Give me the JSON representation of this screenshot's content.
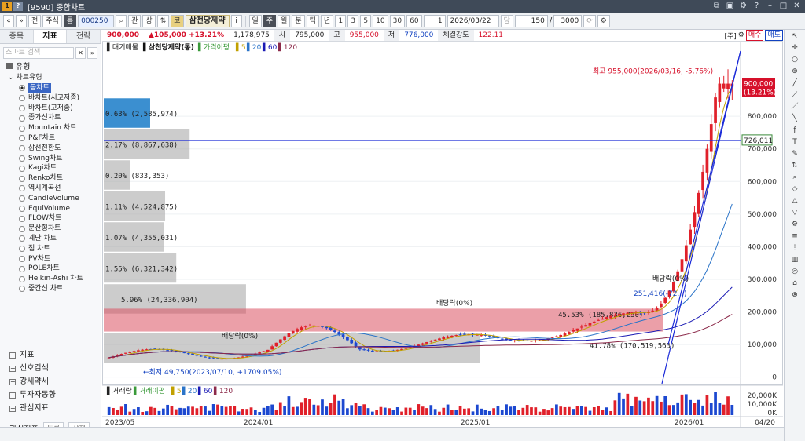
{
  "window": {
    "title": "[9590] 종합차트",
    "badge1": "1",
    "badge2": "?"
  },
  "toolbar": {
    "nav_prev": "«",
    "nav_next": "»",
    "btn_all": "전",
    "btn_stock": "주식",
    "btn_type": "통",
    "code": "000250",
    "btn_gwan": "관",
    "btn_sang": "상",
    "stock_name": "삼천당제약",
    "stock_badge": "코",
    "btn_info": "i",
    "periods": [
      "일",
      "주",
      "월",
      "분",
      "틱",
      "년",
      "1",
      "3",
      "5",
      "10",
      "30",
      "60"
    ],
    "period_selected": "주",
    "step": "1",
    "date": "2026/03/22",
    "btn_date": "당",
    "count": "150",
    "slash": "/",
    "total": "3000",
    "icons": [
      "search-icon",
      "sort-icon",
      "gear-icon"
    ]
  },
  "left_panel": {
    "tabs": [
      "종목",
      "지표",
      "전략"
    ],
    "active_tab": "지표",
    "search_placeholder": "스마트 검색",
    "section": "유형",
    "subsection": "차트유형",
    "chart_types": [
      "봉차트",
      "바차트(시고저종)",
      "바차트(고저종)",
      "종가선차트",
      "Mountain 차트",
      "P&F차트",
      "삼선전환도",
      "Swing차트",
      "Kagi차트",
      "Renko차트",
      "역시계곡선",
      "CandleVolume",
      "EquiVolume",
      "FLOW차트",
      "분산형차트",
      "계단 차트",
      "점 차트",
      "PV차트",
      "POLE차트",
      "Heikin-Ashi 차트",
      "중간선 차트"
    ],
    "selected_chart_type": "봉차트",
    "folders": [
      "지표",
      "신호검색",
      "강세약세",
      "투자자동향",
      "관심지표"
    ],
    "bottom_title": "관심지표",
    "bottom_btn1": "등록",
    "bottom_btn2": "삭제"
  },
  "quote": {
    "price": "900,000",
    "change": "▲105,000",
    "change_rate": "+13.21%",
    "volume": "1,178,975",
    "open_label": "시",
    "open": "795,000",
    "high_label": "고",
    "high": "955,000",
    "low_label": "저",
    "low": "776,000",
    "strength_label": "체결강도",
    "strength": "122.11",
    "unit": "[주]",
    "buy": "매수",
    "sell": "매도"
  },
  "chart_data": {
    "type": "candlestick",
    "title": "대기매물",
    "stock_label": "삼천당제약(통)",
    "ma_label": "가격이평",
    "ma_periods": [
      "5",
      "20",
      "60",
      "120"
    ],
    "ma_colors": [
      "#c1a000",
      "#2b74c8",
      "#1a1ab4",
      "#8c2a4a"
    ],
    "y_ticks": [
      0,
      100000,
      200000,
      300000,
      400000,
      500000,
      600000,
      700000,
      800000
    ],
    "y_tick_labels": [
      "0",
      "100,000",
      "200,000",
      "300,000",
      "400,000",
      "500,000",
      "600,000",
      "700,000",
      "800,000"
    ],
    "ylim": [
      -20000,
      1000000
    ],
    "x_labels": [
      "2023/05",
      "2024/01",
      "2025/01",
      "2026/01"
    ],
    "current_price_label": "900,000",
    "current_rate_label": "(13.21%)",
    "crosshair_label": "726,011",
    "crosshair_value": 726011,
    "high_annotation": "최고 955,000(2026/03/16, -5.76%)",
    "low_annotation": "최저 49,750(2023/07/10, +1709.05%)",
    "dividend_labels": [
      "배당락(0%)",
      "배당락(0%)",
      "배당락(0%)"
    ],
    "intermediate_label": "251,416(-72...)",
    "volume_profile": [
      {
        "lo": 760000,
        "hi": 855000,
        "pct": "0.63%",
        "vol": "(2,585,974)",
        "value": 2585974
      },
      {
        "lo": 665000,
        "hi": 760000,
        "pct": "2.17%",
        "vol": "(8,867,638)",
        "value": 8867638
      },
      {
        "lo": 570000,
        "hi": 665000,
        "pct": "0.20%",
        "vol": "(833,353)",
        "value": 833353
      },
      {
        "lo": 475000,
        "hi": 570000,
        "pct": "1.11%",
        "vol": "(4,524,875)",
        "value": 4524875
      },
      {
        "lo": 380000,
        "hi": 475000,
        "pct": "1.07%",
        "vol": "(4,355,031)",
        "value": 4355031
      },
      {
        "lo": 285000,
        "hi": 380000,
        "pct": "1.55%",
        "vol": "(6,321,342)",
        "value": 6321342
      },
      {
        "lo": 190000,
        "hi": 285000,
        "pct": "5.96%",
        "vol": "(24,336,904)",
        "value": 24336904
      },
      {
        "lo": 135000,
        "hi": 210000,
        "pct": "45.53%",
        "vol": "(185,836,250)",
        "value": 185836250
      },
      {
        "lo": 40000,
        "hi": 135000,
        "pct": "41.78%",
        "vol": "(170,519,563)",
        "value": 170519563
      }
    ],
    "volume_title": "거래량",
    "volume_ma_label": "거래이평",
    "volume_ma_periods": [
      "5",
      "20",
      "60",
      "120"
    ],
    "volume_ticks": [
      "20,000K",
      "10,000K",
      "0K"
    ],
    "last_date": "04/20",
    "candle_seed": 7,
    "up_color": "#e0202a",
    "down_color": "#1c48d0"
  }
}
